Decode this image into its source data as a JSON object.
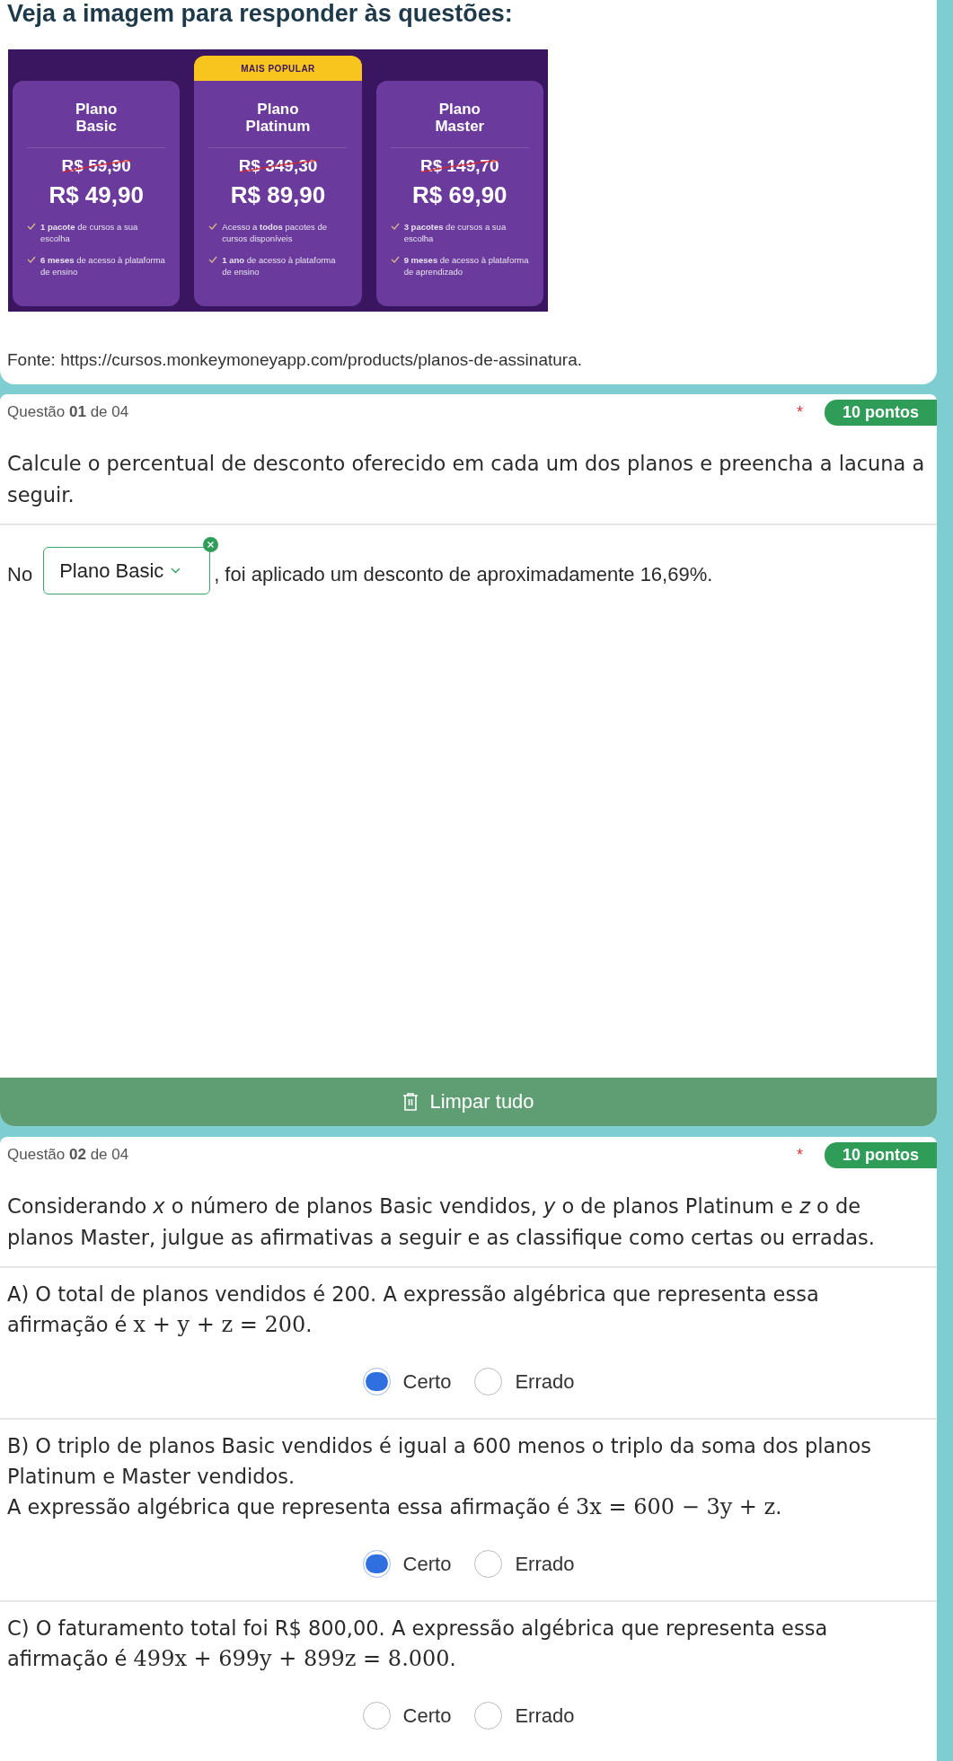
{
  "intro": {
    "title": "Veja a imagem para responder às questões:",
    "pricing": {
      "popular_label": "MAIS POPULAR",
      "plans": [
        {
          "title": "Plano Basic",
          "old_price": "R$ 59,90",
          "price": "R$ 49,90",
          "popular": false,
          "features": [
            "**1 pacote** de cursos a sua escolha",
            "**6 meses** de acesso à plataforma de ensino"
          ]
        },
        {
          "title": "Plano Platinum",
          "old_price": "R$ 349,30",
          "price": "R$ 89,90",
          "popular": true,
          "features": [
            "Acesso a **todos** pacotes de cursos disponíveis",
            "**1 ano** de acesso à plataforma de ensino"
          ]
        },
        {
          "title": "Plano Master",
          "old_price": "R$ 149,70",
          "price": "R$ 69,90",
          "popular": false,
          "features": [
            "**3 pacotes** de cursos a sua escolha",
            "**9 meses** de acesso à plataforma de aprendizado"
          ]
        }
      ]
    },
    "source": "Fonte: https://cursos.monkeymoneyapp.com/products/planos-de-assinatura."
  },
  "question1": {
    "header": "Questão **01** de 04",
    "required_mark": "*",
    "points": "10 pontos",
    "prompt": "Calcule o percentual de desconto oferecido em cada um dos planos e preencha a lacuna a seguir.",
    "answer": {
      "before": "No",
      "select_value": "Plano Basic",
      "after": ", foi aplicado um desconto de aproximadamente 16,69%."
    },
    "clear_button": "Limpar tudo"
  },
  "question2": {
    "header": "Questão **02** de 04",
    "required_mark": "*",
    "points": "10 pontos",
    "prompt": "Considerando *x* o número de planos Basic vendidos, *y* o de planos Platinum e *z* o de planos Master, julgue as afirmativas a seguir e as classifique como certas ou erradas.",
    "items": [
      {
        "paragraphs": [
          [
            {
              "kind": "text",
              "text": "A) O total de planos vendidos é 200. A expressão algébrica que representa essa"
            }
          ],
          [
            {
              "kind": "text",
              "text": "afirmação é "
            },
            {
              "kind": "math",
              "text": "x + y + z = 200"
            },
            {
              "kind": "text",
              "text": "."
            }
          ]
        ],
        "options": [
          {
            "label": "Certo",
            "selected": true
          },
          {
            "label": "Errado",
            "selected": false
          }
        ]
      },
      {
        "paragraphs": [
          [
            {
              "kind": "text",
              "text": "B) O triplo de planos Basic vendidos é igual a 600 menos o triplo da soma dos planos Platinum e Master vendidos."
            }
          ],
          [
            {
              "kind": "text",
              "text": "A expressão algébrica que representa essa afirmação é "
            },
            {
              "kind": "math",
              "text": "3x = 600 − 3y + z"
            },
            {
              "kind": "text",
              "text": "."
            }
          ]
        ],
        "options": [
          {
            "label": "Certo",
            "selected": true
          },
          {
            "label": "Errado",
            "selected": false
          }
        ]
      },
      {
        "paragraphs": [
          [
            {
              "kind": "text",
              "text": "C) O faturamento total foi R$ 800,00. A expressão algébrica que representa essa"
            }
          ],
          [
            {
              "kind": "text",
              "text": "afirmação é "
            },
            {
              "kind": "math",
              "text": "499x + 699y + 899z = 8.000"
            },
            {
              "kind": "text",
              "text": "."
            }
          ]
        ],
        "options": [
          {
            "label": "Certo",
            "selected": false
          },
          {
            "label": "Errado",
            "selected": false
          }
        ]
      }
    ]
  }
}
